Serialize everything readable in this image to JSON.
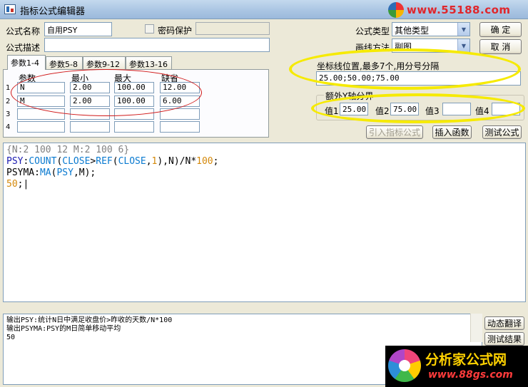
{
  "window": {
    "title": "指标公式编辑器"
  },
  "watermark_top": {
    "text": "www.55188.com"
  },
  "formula": {
    "name_label": "公式名称",
    "name_value": "自用PSY",
    "password_label": "密码保护",
    "password_value": "",
    "desc_label": "公式描述",
    "desc_value": "",
    "type_label": "公式类型",
    "type_value": "其他类型",
    "draw_label": "画线方法",
    "draw_value": "副图"
  },
  "buttons": {
    "ok": "确  定",
    "cancel": "取  消",
    "import": "引入指标公式",
    "insert_fn": "插入函数",
    "test": "测试公式",
    "translate": "动态翻译",
    "test_result": "测试结果"
  },
  "tabs": [
    "参数1-4",
    "参数5-8",
    "参数9-12",
    "参数13-16"
  ],
  "params": {
    "headers": [
      "参数",
      "最小",
      "最大",
      "缺省"
    ],
    "rows": [
      {
        "num": "1",
        "name": "N",
        "min": "2.00",
        "max": "100.00",
        "def": "12.00"
      },
      {
        "num": "2",
        "name": "M",
        "min": "2.00",
        "max": "100.00",
        "def": "6.00"
      },
      {
        "num": "3",
        "name": "",
        "min": "",
        "max": "",
        "def": ""
      },
      {
        "num": "4",
        "name": "",
        "min": "",
        "max": "",
        "def": ""
      }
    ]
  },
  "axis_lines": {
    "label": "坐标线位置,最多7个,用分号分隔",
    "value": "25.00;50.00;75.00"
  },
  "extra_y": {
    "group_label": "额外Y轴分界",
    "labels": [
      "值1",
      "值2",
      "值3",
      "值4"
    ],
    "values": [
      "25.00",
      "75.00",
      "",
      ""
    ]
  },
  "code": {
    "line1": "{N:2 100 12 M:2 100 6}",
    "line2": {
      "var": "PSY",
      "colon": ":",
      "fn1": "COUNT",
      "p1": "(",
      "arg1": "CLOSE",
      "op": ">",
      "fn2": "REF",
      "p2": "(",
      "arg2": "CLOSE",
      "comma": ",",
      "num1": "1",
      "rest": "),N)/N*",
      "num2": "100",
      "end": ";"
    },
    "line3": {
      "var": "PSYMA",
      "colon": ":",
      "fn": "MA",
      "p": "(",
      "arg": "PSY",
      "rest": ",M);"
    },
    "line4": {
      "num": "50",
      "end": ";"
    }
  },
  "output": {
    "lines": [
      "输出PSY:统计N日中满足收盘价>昨收的天数/N*100",
      "输出PSYMA:PSY的M日简单移动平均",
      "50"
    ]
  },
  "promo": {
    "title": "分析家公式网",
    "url": "www.88gs.com"
  },
  "colors": {
    "ellipse_red": "#d01818",
    "ellipse_yellow": "#f6ea00"
  }
}
